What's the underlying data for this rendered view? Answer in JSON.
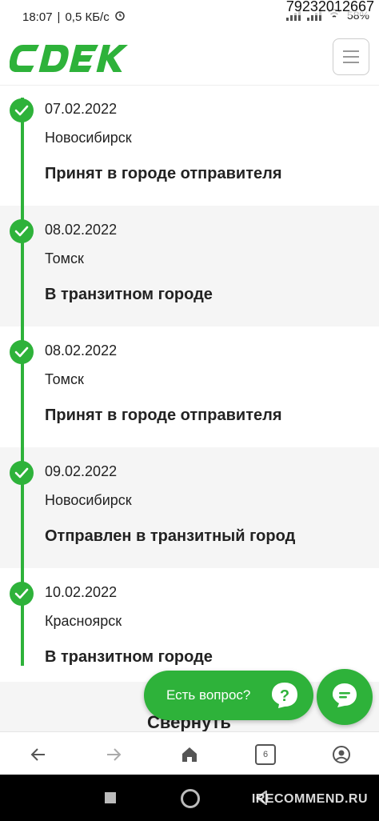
{
  "status_bar": {
    "time": "18:07",
    "speed": "0,5 КБ/с",
    "battery": "58%",
    "phone_watermark": "79232012667"
  },
  "header": {
    "logo_text": "СDEK"
  },
  "timeline": [
    {
      "date": "07.02.2022",
      "city": "Новосибирск",
      "status": "Принят в городе отправителя"
    },
    {
      "date": "08.02.2022",
      "city": "Томск",
      "status": "В транзитном городе"
    },
    {
      "date": "08.02.2022",
      "city": "Томск",
      "status": "Принят в городе отправителя"
    },
    {
      "date": "09.02.2022",
      "city": "Новосибирск",
      "status": "Отправлен в транзитный город"
    },
    {
      "date": "10.02.2022",
      "city": "Красноярск",
      "status": "В транзитном городе"
    }
  ],
  "collapse_label": "Свернуть",
  "chat": {
    "ask_label": "Есть вопрос?"
  },
  "browser_bar": {
    "tabs_count": "6"
  },
  "watermark": "IRECOMMEND.RU",
  "colors": {
    "brand_green": "#2eb23a"
  }
}
